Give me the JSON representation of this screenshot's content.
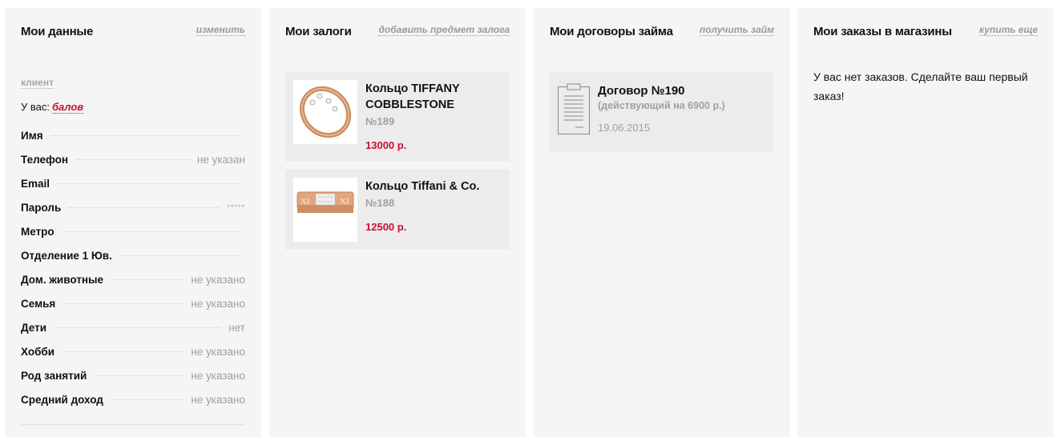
{
  "profile": {
    "title": "Мои данные",
    "edit_label": "изменить",
    "role": "клиент",
    "balance_prefix": "У вас:",
    "balance_link": "балов",
    "fields": [
      {
        "label": "Имя",
        "value": ""
      },
      {
        "label": "Телефон",
        "value": "не указан"
      },
      {
        "label": "Email",
        "value": ""
      },
      {
        "label": "Пароль",
        "value": "*****"
      },
      {
        "label": "Метро",
        "value": ""
      },
      {
        "label": "Отделение 1 Юв.",
        "value": ""
      },
      {
        "label": "Дом. животные",
        "value": "не указано"
      },
      {
        "label": "Семья",
        "value": "не указано"
      },
      {
        "label": "Дети",
        "value": "нет"
      },
      {
        "label": "Хобби",
        "value": "не указано"
      },
      {
        "label": "Род занятий",
        "value": "не указано"
      },
      {
        "label": "Средний доход",
        "value": "не указано"
      }
    ]
  },
  "pledges": {
    "title": "Мои залоги",
    "add_label": "добавить предмет залога",
    "items": [
      {
        "name": "Кольцо TIFFANY COBBLESTONE",
        "number": "№189",
        "price": "13000 р."
      },
      {
        "name": "Кольцо Tiffani & Co.",
        "number": "№188",
        "price": "12500 р."
      }
    ]
  },
  "loans": {
    "title": "Мои договоры займа",
    "get_label": "получить займ",
    "contract": {
      "name": "Договор №190",
      "status": "(действующий на 6900 р.)",
      "date": "19.06.2015"
    }
  },
  "orders": {
    "title": "Мои заказы в магазины",
    "buy_label": "купить еще",
    "empty_text": "У вас нет заказов. Сделайте ваш первый заказ!"
  },
  "colors": {
    "accent": "#c8102e",
    "panel": "#f5f5f5",
    "card": "#ececec",
    "muted": "#a0a0a0"
  }
}
